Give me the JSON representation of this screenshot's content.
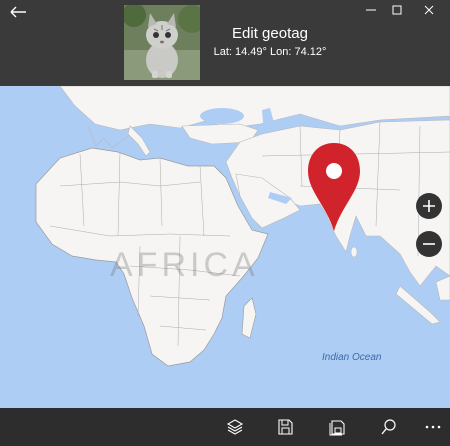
{
  "window": {
    "title": "Edit geotag",
    "latitude_text": "Lat: 14.49°  Lon: 74.12°",
    "controls": [
      "back",
      "minimize",
      "maximize",
      "close"
    ]
  },
  "map": {
    "labels": {
      "continent": "AFRICA",
      "ocean": "Indian Ocean"
    },
    "zoom_in_icon": "plus-icon",
    "zoom_out_icon": "minus-icon",
    "pin_icon": "map-pin-icon",
    "pin_color": "#d0232b",
    "land_color": "#f6f5f3",
    "water_color": "#aecdf5"
  },
  "toolbar": {
    "buttons": [
      "layers-icon",
      "save-icon",
      "save-copy-icon",
      "search-icon",
      "more-icon"
    ]
  },
  "colors": {
    "titlebar": "#3a3a3a",
    "toolbar": "#2d2d2d"
  }
}
